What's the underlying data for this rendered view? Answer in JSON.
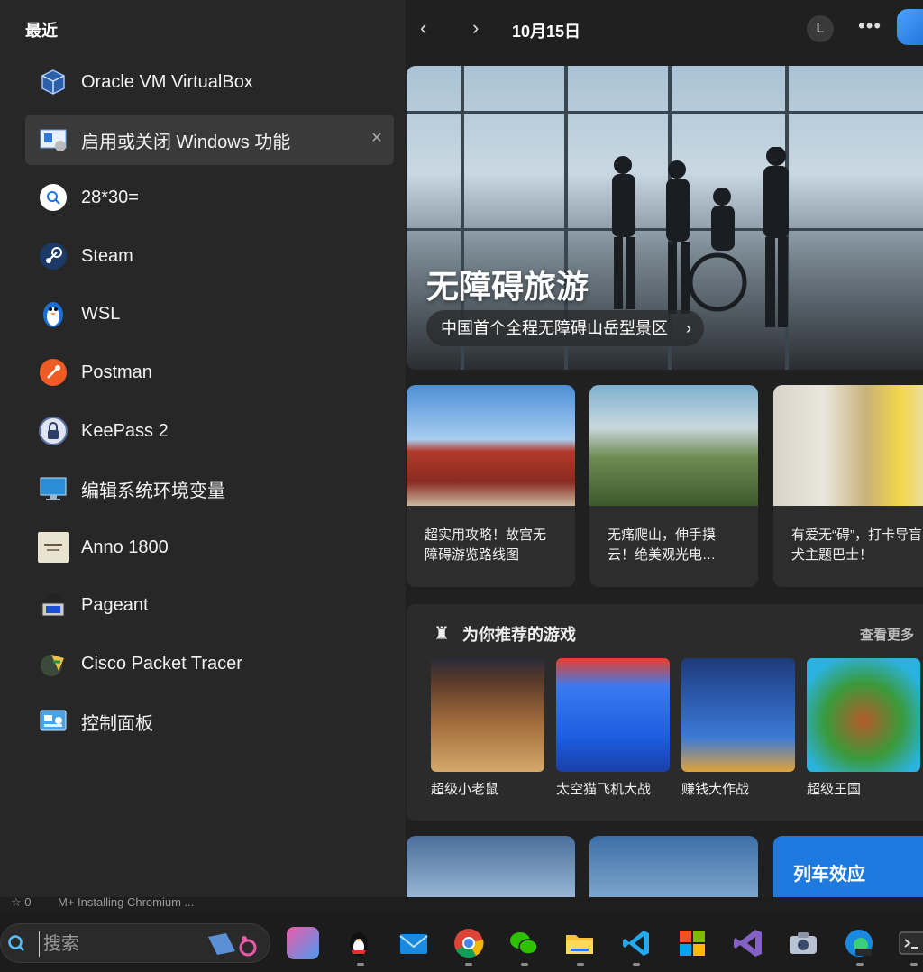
{
  "left_panel": {
    "title": "最近",
    "items": [
      {
        "label": "Oracle VM VirtualBox",
        "icon": "virtualbox-icon"
      },
      {
        "label": "启用或关闭 Windows 功能",
        "icon": "windows-features-icon",
        "selected": true
      },
      {
        "label": "28*30=",
        "icon": "search-calc-icon"
      },
      {
        "label": "Steam",
        "icon": "steam-icon"
      },
      {
        "label": "WSL",
        "icon": "wsl-penguin-icon"
      },
      {
        "label": "Postman",
        "icon": "postman-icon"
      },
      {
        "label": "KeePass 2",
        "icon": "keepass-icon"
      },
      {
        "label": "编辑系统环境变量",
        "icon": "system-env-icon"
      },
      {
        "label": "Anno 1800",
        "icon": "anno-icon"
      },
      {
        "label": "Pageant",
        "icon": "pageant-icon"
      },
      {
        "label": "Cisco Packet Tracer",
        "icon": "packet-tracer-icon"
      },
      {
        "label": "控制面板",
        "icon": "control-panel-icon"
      }
    ],
    "close_glyph": "✕"
  },
  "header": {
    "back": "‹",
    "forward": "›",
    "date": "10月15日",
    "avatar_letter": "L",
    "more": "•••"
  },
  "hero": {
    "title": "无障碍旅游",
    "subtitle": "中国首个全程无障碍山岳型景区",
    "chevron": "›"
  },
  "cards": [
    {
      "text": "超实用攻略！故宫无障碍游览路线图"
    },
    {
      "text": "无痛爬山，伸手摸云！绝美观光电…"
    },
    {
      "text": "有爱无“碍”，打卡导盲犬主题巴士！"
    }
  ],
  "games": {
    "title": "为你推荐的游戏",
    "more": "查看更多",
    "items": [
      {
        "name": "超级小老鼠"
      },
      {
        "name": "太空猫飞机大战"
      },
      {
        "name": "赚钱大作战"
      },
      {
        "name": "超级王国"
      }
    ]
  },
  "bottom_cards": [
    {
      "text": ""
    },
    {
      "text": ""
    },
    {
      "text": "列车效应"
    }
  ],
  "status_bar": {
    "left": "☆ 0",
    "task": "M+ Installing Chromium ..."
  },
  "taskbar": {
    "search_placeholder": "搜索",
    "apps": [
      "copilot-pre-icon",
      "qq-icon",
      "mail-icon",
      "chrome-icon",
      "wechat-icon",
      "file-explorer-icon",
      "vscode-icon",
      "ms-store-icon",
      "visual-studio-icon",
      "camera-icon",
      "edge-dev-icon",
      "terminal-icon"
    ]
  },
  "colors": {
    "accent": "#1f6fd9",
    "panel": "#272727",
    "selected": "#3a3a3a"
  }
}
